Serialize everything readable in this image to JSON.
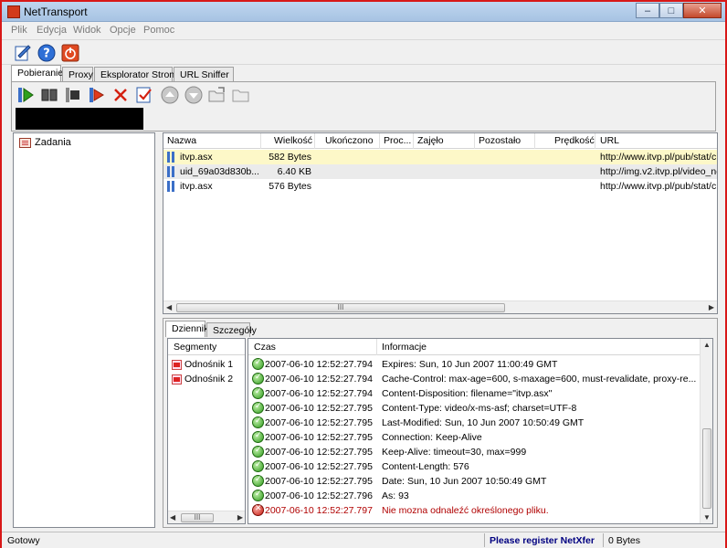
{
  "window": {
    "title": "NetTransport",
    "controls": {
      "minimize": "–",
      "maximize": "□",
      "close": "✕"
    }
  },
  "menu": [
    "Plik",
    "Edycja",
    "Widok",
    "Opcje",
    "Pomoc"
  ],
  "main_tabs": [
    {
      "label": "Pobieranie",
      "active": true
    },
    {
      "label": "Proxy",
      "active": false
    },
    {
      "label": "Eksplorator Stron",
      "active": false
    },
    {
      "label": "URL Sniffer",
      "active": false
    }
  ],
  "toolbar_icons": [
    "new-task-icon",
    "help-icon",
    "power-icon"
  ],
  "download_toolbar_icons": [
    "start-icon",
    "pause-icon",
    "stop-icon",
    "start-marker-icon",
    "delete-icon",
    "check-icon",
    "move-up-icon",
    "move-down-icon",
    "open-folder-icon",
    "folder-icon"
  ],
  "tree": {
    "root": "Zadania"
  },
  "columns": [
    "Nazwa",
    "Wielkość",
    "Ukończono",
    "Proc...",
    "Zajęło",
    "Pozostało",
    "Prędkość",
    "URL"
  ],
  "downloads": [
    {
      "name": "itvp.asx",
      "size": "582 Bytes",
      "url": "http://www.itvp.pl/pub/stat/c"
    },
    {
      "name": "uid_69a03d830b...",
      "size": "6.40 KB",
      "url": "http://img.v2.itvp.pl/video_ne"
    },
    {
      "name": "itvp.asx",
      "size": "576 Bytes",
      "url": "http://www.itvp.pl/pub/stat/c"
    }
  ],
  "scrollbar_grip": "III",
  "detail_tabs": [
    {
      "label": "Dziennik",
      "active": true
    },
    {
      "label": "Szczegóły",
      "active": false
    }
  ],
  "segments": {
    "header": "Segmenty",
    "items": [
      "Odnośnik 1",
      "Odnośnik 2"
    ]
  },
  "log": {
    "col_time": "Czas",
    "col_info": "Informacje",
    "rows": [
      {
        "status": "ok",
        "time": "2007-06-10 12:52:27.794",
        "info": "Expires: Sun, 10 Jun 2007 11:00:49 GMT"
      },
      {
        "status": "ok",
        "time": "2007-06-10 12:52:27.794",
        "info": "Cache-Control: max-age=600, s-maxage=600, must-revalidate, proxy-re..."
      },
      {
        "status": "ok",
        "time": "2007-06-10 12:52:27.794",
        "info": "Content-Disposition: filename=\"itvp.asx\""
      },
      {
        "status": "ok",
        "time": "2007-06-10 12:52:27.795",
        "info": "Content-Type: video/x-ms-asf; charset=UTF-8"
      },
      {
        "status": "ok",
        "time": "2007-06-10 12:52:27.795",
        "info": "Last-Modified: Sun, 10 Jun 2007 10:50:49 GMT"
      },
      {
        "status": "ok",
        "time": "2007-06-10 12:52:27.795",
        "info": "Connection: Keep-Alive"
      },
      {
        "status": "ok",
        "time": "2007-06-10 12:52:27.795",
        "info": "Keep-Alive: timeout=30, max=999"
      },
      {
        "status": "ok",
        "time": "2007-06-10 12:52:27.795",
        "info": "Content-Length: 576"
      },
      {
        "status": "ok",
        "time": "2007-06-10 12:52:27.795",
        "info": "Date: Sun, 10 Jun 2007 10:50:49 GMT"
      },
      {
        "status": "ok",
        "time": "2007-06-10 12:52:27.796",
        "info": "As: 93"
      },
      {
        "status": "err",
        "time": "2007-06-10 12:52:27.797",
        "info": "Nie mozna odnaleźć określonego pliku."
      }
    ]
  },
  "statusbar": {
    "left": "Gotowy",
    "register": "Please register NetXfer",
    "bytes": "0 Bytes"
  },
  "colors": {
    "selected_row": "#fdf8c8",
    "error_text": "#b00000",
    "frame": "#d81818",
    "register_text": "#000080"
  }
}
